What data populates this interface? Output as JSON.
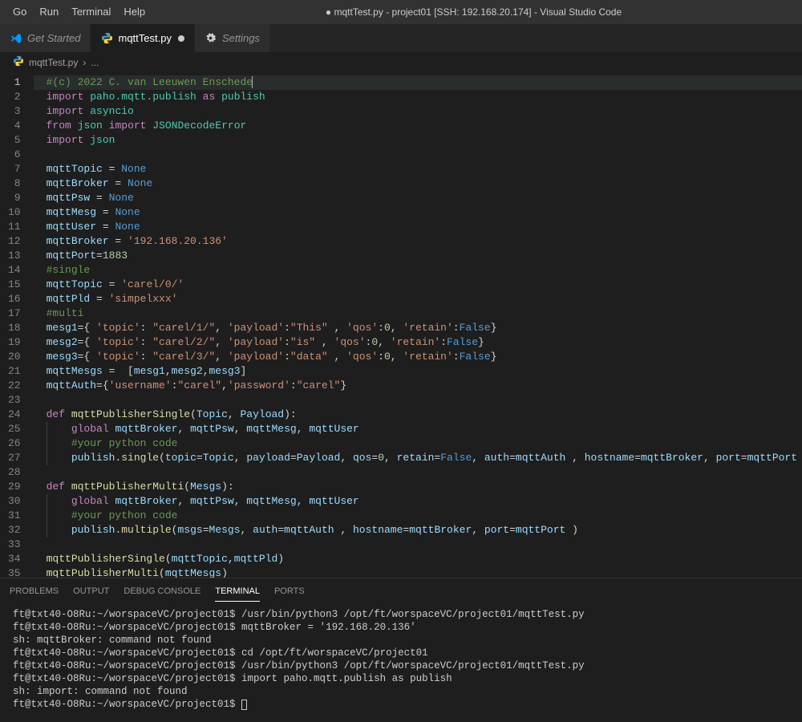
{
  "menu": {
    "items": [
      "Go",
      "Run",
      "Terminal",
      "Help"
    ]
  },
  "window_title": "● mqttTest.py - project01 [SSH: 192.168.20.174] - Visual Studio Code",
  "tabs": [
    {
      "label": "Get Started",
      "icon": "vscode",
      "active": false,
      "italic": true,
      "dirty": false
    },
    {
      "label": "mqttTest.py",
      "icon": "python",
      "active": true,
      "italic": false,
      "dirty": true
    },
    {
      "label": "Settings",
      "icon": "gear",
      "active": false,
      "italic": true,
      "dirty": false
    }
  ],
  "breadcrumb": {
    "file_icon": "python",
    "file": "mqttTest.py",
    "sep": "›",
    "more": "..."
  },
  "editor": {
    "current_line": 1,
    "lines": [
      {
        "n": 1,
        "indent": 0,
        "hl": true,
        "tokens": [
          [
            "comment",
            "#(c) 2022 C. van Leeuwen Enschede"
          ],
          [
            "cursor",
            ""
          ]
        ]
      },
      {
        "n": 2,
        "indent": 0,
        "tokens": [
          [
            "keyword",
            "import"
          ],
          [
            "plain",
            " "
          ],
          [
            "module",
            "paho.mqtt.publish"
          ],
          [
            "plain",
            " "
          ],
          [
            "keyword",
            "as"
          ],
          [
            "plain",
            " "
          ],
          [
            "module",
            "publish"
          ]
        ]
      },
      {
        "n": 3,
        "indent": 0,
        "tokens": [
          [
            "keyword",
            "import"
          ],
          [
            "plain",
            " "
          ],
          [
            "module",
            "asyncio"
          ]
        ]
      },
      {
        "n": 4,
        "indent": 0,
        "tokens": [
          [
            "keyword",
            "from"
          ],
          [
            "plain",
            " "
          ],
          [
            "module",
            "json"
          ],
          [
            "plain",
            " "
          ],
          [
            "keyword",
            "import"
          ],
          [
            "plain",
            " "
          ],
          [
            "module",
            "JSONDecodeError"
          ]
        ]
      },
      {
        "n": 5,
        "indent": 0,
        "tokens": [
          [
            "keyword",
            "import"
          ],
          [
            "plain",
            " "
          ],
          [
            "module",
            "json"
          ]
        ]
      },
      {
        "n": 6,
        "indent": 0,
        "tokens": []
      },
      {
        "n": 7,
        "indent": 0,
        "tokens": [
          [
            "var",
            "mqttTopic"
          ],
          [
            "plain",
            " = "
          ],
          [
            "const",
            "None"
          ]
        ]
      },
      {
        "n": 8,
        "indent": 0,
        "tokens": [
          [
            "var",
            "mqttBroker"
          ],
          [
            "plain",
            " = "
          ],
          [
            "const",
            "None"
          ]
        ]
      },
      {
        "n": 9,
        "indent": 0,
        "tokens": [
          [
            "var",
            "mqttPsw"
          ],
          [
            "plain",
            " = "
          ],
          [
            "const",
            "None"
          ]
        ]
      },
      {
        "n": 10,
        "indent": 0,
        "tokens": [
          [
            "var",
            "mqttMesg"
          ],
          [
            "plain",
            " = "
          ],
          [
            "const",
            "None"
          ]
        ]
      },
      {
        "n": 11,
        "indent": 0,
        "tokens": [
          [
            "var",
            "mqttUser"
          ],
          [
            "plain",
            " = "
          ],
          [
            "const",
            "None"
          ]
        ]
      },
      {
        "n": 12,
        "indent": 0,
        "tokens": [
          [
            "var",
            "mqttBroker"
          ],
          [
            "plain",
            " = "
          ],
          [
            "str",
            "'192.168.20.136'"
          ]
        ]
      },
      {
        "n": 13,
        "indent": 0,
        "tokens": [
          [
            "var",
            "mqttPort"
          ],
          [
            "plain",
            "="
          ],
          [
            "num",
            "1883"
          ]
        ]
      },
      {
        "n": 14,
        "indent": 0,
        "tokens": [
          [
            "comment",
            "#single"
          ]
        ]
      },
      {
        "n": 15,
        "indent": 0,
        "tokens": [
          [
            "var",
            "mqttTopic"
          ],
          [
            "plain",
            " = "
          ],
          [
            "str",
            "'carel/0/'"
          ]
        ]
      },
      {
        "n": 16,
        "indent": 0,
        "tokens": [
          [
            "var",
            "mqttPld"
          ],
          [
            "plain",
            " = "
          ],
          [
            "str",
            "'simpelxxx'"
          ]
        ]
      },
      {
        "n": 17,
        "indent": 0,
        "tokens": [
          [
            "comment",
            "#multi"
          ]
        ]
      },
      {
        "n": 18,
        "indent": 0,
        "tokens": [
          [
            "var",
            "mesg1"
          ],
          [
            "plain",
            "={ "
          ],
          [
            "str",
            "'topic'"
          ],
          [
            "plain",
            ": "
          ],
          [
            "str",
            "\"carel/1/\""
          ],
          [
            "plain",
            ", "
          ],
          [
            "str",
            "'payload'"
          ],
          [
            "plain",
            ":"
          ],
          [
            "str",
            "\"This\""
          ],
          [
            "plain",
            " , "
          ],
          [
            "str",
            "'qos'"
          ],
          [
            "plain",
            ":"
          ],
          [
            "num",
            "0"
          ],
          [
            "plain",
            ", "
          ],
          [
            "str",
            "'retain'"
          ],
          [
            "plain",
            ":"
          ],
          [
            "const",
            "False"
          ],
          [
            "plain",
            "}"
          ]
        ]
      },
      {
        "n": 19,
        "indent": 0,
        "tokens": [
          [
            "var",
            "mesg2"
          ],
          [
            "plain",
            "={ "
          ],
          [
            "str",
            "'topic'"
          ],
          [
            "plain",
            ": "
          ],
          [
            "str",
            "\"carel/2/\""
          ],
          [
            "plain",
            ", "
          ],
          [
            "str",
            "'payload'"
          ],
          [
            "plain",
            ":"
          ],
          [
            "str",
            "\"is\""
          ],
          [
            "plain",
            " , "
          ],
          [
            "str",
            "'qos'"
          ],
          [
            "plain",
            ":"
          ],
          [
            "num",
            "0"
          ],
          [
            "plain",
            ", "
          ],
          [
            "str",
            "'retain'"
          ],
          [
            "plain",
            ":"
          ],
          [
            "const",
            "False"
          ],
          [
            "plain",
            "}"
          ]
        ]
      },
      {
        "n": 20,
        "indent": 0,
        "tokens": [
          [
            "var",
            "mesg3"
          ],
          [
            "plain",
            "={ "
          ],
          [
            "str",
            "'topic'"
          ],
          [
            "plain",
            ": "
          ],
          [
            "str",
            "\"carel/3/\""
          ],
          [
            "plain",
            ", "
          ],
          [
            "str",
            "'payload'"
          ],
          [
            "plain",
            ":"
          ],
          [
            "str",
            "\"data\""
          ],
          [
            "plain",
            " , "
          ],
          [
            "str",
            "'qos'"
          ],
          [
            "plain",
            ":"
          ],
          [
            "num",
            "0"
          ],
          [
            "plain",
            ", "
          ],
          [
            "str",
            "'retain'"
          ],
          [
            "plain",
            ":"
          ],
          [
            "const",
            "False"
          ],
          [
            "plain",
            "}"
          ]
        ]
      },
      {
        "n": 21,
        "indent": 0,
        "tokens": [
          [
            "var",
            "mqttMesgs"
          ],
          [
            "plain",
            " =  ["
          ],
          [
            "var",
            "mesg1"
          ],
          [
            "plain",
            ","
          ],
          [
            "var",
            "mesg2"
          ],
          [
            "plain",
            ","
          ],
          [
            "var",
            "mesg3"
          ],
          [
            "plain",
            "]"
          ]
        ]
      },
      {
        "n": 22,
        "indent": 0,
        "tokens": [
          [
            "var",
            "mqttAuth"
          ],
          [
            "plain",
            "={"
          ],
          [
            "str",
            "'username'"
          ],
          [
            "plain",
            ":"
          ],
          [
            "str",
            "\"carel\""
          ],
          [
            "plain",
            ","
          ],
          [
            "str",
            "'password'"
          ],
          [
            "plain",
            ":"
          ],
          [
            "str",
            "\"carel\""
          ],
          [
            "plain",
            "}"
          ]
        ]
      },
      {
        "n": 23,
        "indent": 0,
        "tokens": []
      },
      {
        "n": 24,
        "indent": 0,
        "tokens": [
          [
            "keyword",
            "def"
          ],
          [
            "plain",
            " "
          ],
          [
            "fn",
            "mqttPublisherSingle"
          ],
          [
            "plain",
            "("
          ],
          [
            "var",
            "Topic"
          ],
          [
            "plain",
            ", "
          ],
          [
            "var",
            "Payload"
          ],
          [
            "plain",
            "):"
          ]
        ]
      },
      {
        "n": 25,
        "indent": 1,
        "tokens": [
          [
            "keyword",
            "global"
          ],
          [
            "plain",
            " "
          ],
          [
            "var",
            "mqttBroker"
          ],
          [
            "plain",
            ", "
          ],
          [
            "var",
            "mqttPsw"
          ],
          [
            "plain",
            ", "
          ],
          [
            "var",
            "mqttMesg"
          ],
          [
            "plain",
            ", "
          ],
          [
            "var",
            "mqttUser"
          ]
        ]
      },
      {
        "n": 26,
        "indent": 1,
        "tokens": [
          [
            "comment",
            "#your python code"
          ]
        ]
      },
      {
        "n": 27,
        "indent": 1,
        "tokens": [
          [
            "var",
            "publish"
          ],
          [
            "plain",
            "."
          ],
          [
            "fn",
            "single"
          ],
          [
            "plain",
            "("
          ],
          [
            "var",
            "topic"
          ],
          [
            "plain",
            "="
          ],
          [
            "var",
            "Topic"
          ],
          [
            "plain",
            ", "
          ],
          [
            "var",
            "payload"
          ],
          [
            "plain",
            "="
          ],
          [
            "var",
            "Payload"
          ],
          [
            "plain",
            ", "
          ],
          [
            "var",
            "qos"
          ],
          [
            "plain",
            "="
          ],
          [
            "num",
            "0"
          ],
          [
            "plain",
            ", "
          ],
          [
            "var",
            "retain"
          ],
          [
            "plain",
            "="
          ],
          [
            "const",
            "False"
          ],
          [
            "plain",
            ", "
          ],
          [
            "var",
            "auth"
          ],
          [
            "plain",
            "="
          ],
          [
            "var",
            "mqttAuth"
          ],
          [
            "plain",
            " , "
          ],
          [
            "var",
            "hostname"
          ],
          [
            "plain",
            "="
          ],
          [
            "var",
            "mqttBroker"
          ],
          [
            "plain",
            ", "
          ],
          [
            "var",
            "port"
          ],
          [
            "plain",
            "="
          ],
          [
            "var",
            "mqttPort"
          ],
          [
            "plain",
            " )"
          ]
        ]
      },
      {
        "n": 28,
        "indent": 0,
        "tokens": []
      },
      {
        "n": 29,
        "indent": 0,
        "tokens": [
          [
            "keyword",
            "def"
          ],
          [
            "plain",
            " "
          ],
          [
            "fn",
            "mqttPublisherMulti"
          ],
          [
            "plain",
            "("
          ],
          [
            "var",
            "Mesgs"
          ],
          [
            "plain",
            "):"
          ]
        ]
      },
      {
        "n": 30,
        "indent": 1,
        "tokens": [
          [
            "keyword",
            "global"
          ],
          [
            "plain",
            " "
          ],
          [
            "var",
            "mqttBroker"
          ],
          [
            "plain",
            ", "
          ],
          [
            "var",
            "mqttPsw"
          ],
          [
            "plain",
            ", "
          ],
          [
            "var",
            "mqttMesg"
          ],
          [
            "plain",
            ", "
          ],
          [
            "var",
            "mqttUser"
          ]
        ]
      },
      {
        "n": 31,
        "indent": 1,
        "tokens": [
          [
            "comment",
            "#your python code"
          ]
        ]
      },
      {
        "n": 32,
        "indent": 1,
        "tokens": [
          [
            "var",
            "publish"
          ],
          [
            "plain",
            "."
          ],
          [
            "fn",
            "multiple"
          ],
          [
            "plain",
            "("
          ],
          [
            "var",
            "msgs"
          ],
          [
            "plain",
            "="
          ],
          [
            "var",
            "Mesgs"
          ],
          [
            "plain",
            ", "
          ],
          [
            "var",
            "auth"
          ],
          [
            "plain",
            "="
          ],
          [
            "var",
            "mqttAuth"
          ],
          [
            "plain",
            " , "
          ],
          [
            "var",
            "hostname"
          ],
          [
            "plain",
            "="
          ],
          [
            "var",
            "mqttBroker"
          ],
          [
            "plain",
            ", "
          ],
          [
            "var",
            "port"
          ],
          [
            "plain",
            "="
          ],
          [
            "var",
            "mqttPort"
          ],
          [
            "plain",
            " )"
          ]
        ]
      },
      {
        "n": 33,
        "indent": 0,
        "tokens": []
      },
      {
        "n": 34,
        "indent": 0,
        "tokens": [
          [
            "fn",
            "mqttPublisherSingle"
          ],
          [
            "plain",
            "("
          ],
          [
            "var",
            "mqttTopic"
          ],
          [
            "plain",
            ","
          ],
          [
            "var",
            "mqttPld"
          ],
          [
            "plain",
            ")"
          ]
        ]
      },
      {
        "n": 35,
        "indent": 0,
        "tokens": [
          [
            "fn",
            "mqttPublisherMulti"
          ],
          [
            "plain",
            "("
          ],
          [
            "var",
            "mqttMesgs"
          ],
          [
            "plain",
            ")"
          ]
        ]
      }
    ]
  },
  "panel": {
    "tabs": [
      "PROBLEMS",
      "OUTPUT",
      "DEBUG CONSOLE",
      "TERMINAL",
      "PORTS"
    ],
    "active_tab": 3,
    "terminal_lines": [
      "ft@txt40-O8Ru:~/worspaceVC/project01$ /usr/bin/python3 /opt/ft/worspaceVC/project01/mqttTest.py",
      "ft@txt40-O8Ru:~/worspaceVC/project01$ mqttBroker = '192.168.20.136'",
      "sh: mqttBroker: command not found",
      "ft@txt40-O8Ru:~/worspaceVC/project01$ cd /opt/ft/worspaceVC/project01",
      "ft@txt40-O8Ru:~/worspaceVC/project01$ /usr/bin/python3 /opt/ft/worspaceVC/project01/mqttTest.py",
      "ft@txt40-O8Ru:~/worspaceVC/project01$ import paho.mqtt.publish as publish",
      "sh: import: command not found",
      "ft@txt40-O8Ru:~/worspaceVC/project01$ "
    ]
  }
}
